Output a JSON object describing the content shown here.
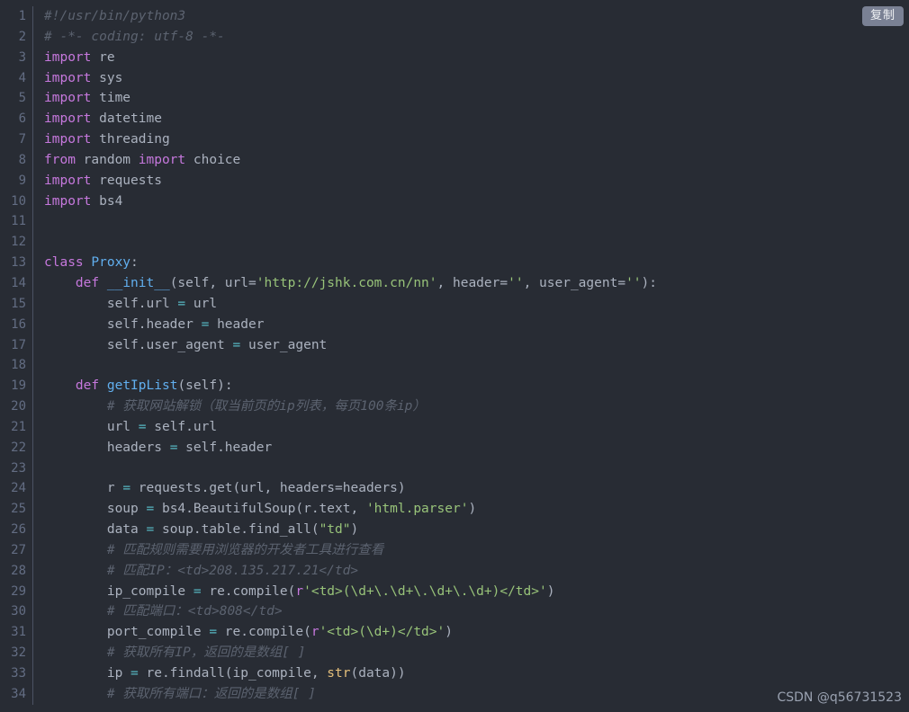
{
  "editor": {
    "language": "python",
    "theme_background": "#282c34",
    "gutter_divider_color": "#4b5263",
    "copy_button_label": "复制",
    "copy_button_color": "#7a8194",
    "watermark": "CSDN @q56731523",
    "first_line_number": 1,
    "last_line_number": 34,
    "line_numbers": [
      "1",
      "2",
      "3",
      "4",
      "5",
      "6",
      "7",
      "8",
      "9",
      "10",
      "11",
      "12",
      "13",
      "14",
      "15",
      "16",
      "17",
      "18",
      "19",
      "20",
      "21",
      "22",
      "23",
      "24",
      "25",
      "26",
      "27",
      "28",
      "29",
      "30",
      "31",
      "32",
      "33",
      "34"
    ],
    "colors": {
      "keyword": "#c678dd",
      "function": "#61afef",
      "string": "#98c379",
      "comment": "#5c6370",
      "operator": "#56b6c2",
      "builtin": "#e5c07b",
      "plain": "#abb2bf",
      "line_number": "#636d83"
    },
    "lines": [
      {
        "n": 1,
        "tokens": [
          {
            "t": "#!/usr/bin/python3",
            "c": "com"
          }
        ]
      },
      {
        "n": 2,
        "tokens": [
          {
            "t": "# -*- coding: utf-8 -*-",
            "c": "com"
          }
        ]
      },
      {
        "n": 3,
        "tokens": [
          {
            "t": "import",
            "c": "kw"
          },
          {
            "t": " re",
            "c": "pl"
          }
        ]
      },
      {
        "n": 4,
        "tokens": [
          {
            "t": "import",
            "c": "kw"
          },
          {
            "t": " sys",
            "c": "pl"
          }
        ]
      },
      {
        "n": 5,
        "tokens": [
          {
            "t": "import",
            "c": "kw"
          },
          {
            "t": " time",
            "c": "pl"
          }
        ]
      },
      {
        "n": 6,
        "tokens": [
          {
            "t": "import",
            "c": "kw"
          },
          {
            "t": " datetime",
            "c": "pl"
          }
        ]
      },
      {
        "n": 7,
        "tokens": [
          {
            "t": "import",
            "c": "kw"
          },
          {
            "t": " threading",
            "c": "pl"
          }
        ]
      },
      {
        "n": 8,
        "tokens": [
          {
            "t": "from",
            "c": "kw"
          },
          {
            "t": " random ",
            "c": "pl"
          },
          {
            "t": "import",
            "c": "kw"
          },
          {
            "t": " choice",
            "c": "pl"
          }
        ]
      },
      {
        "n": 9,
        "tokens": [
          {
            "t": "import",
            "c": "kw"
          },
          {
            "t": " requests",
            "c": "pl"
          }
        ]
      },
      {
        "n": 10,
        "tokens": [
          {
            "t": "import",
            "c": "kw"
          },
          {
            "t": " bs4",
            "c": "pl"
          }
        ]
      },
      {
        "n": 11,
        "tokens": []
      },
      {
        "n": 12,
        "tokens": []
      },
      {
        "n": 13,
        "tokens": [
          {
            "t": "class",
            "c": "kw"
          },
          {
            "t": " ",
            "c": "pl"
          },
          {
            "t": "Proxy",
            "c": "fn"
          },
          {
            "t": ":",
            "c": "pn"
          }
        ]
      },
      {
        "n": 14,
        "tokens": [
          {
            "t": "    ",
            "c": "pl"
          },
          {
            "t": "def",
            "c": "kw"
          },
          {
            "t": " ",
            "c": "pl"
          },
          {
            "t": "__init__",
            "c": "fn"
          },
          {
            "t": "(self, url=",
            "c": "pl"
          },
          {
            "t": "'http://jshk.com.cn/nn'",
            "c": "str"
          },
          {
            "t": ", header=",
            "c": "pl"
          },
          {
            "t": "''",
            "c": "str"
          },
          {
            "t": ", user_agent=",
            "c": "pl"
          },
          {
            "t": "''",
            "c": "str"
          },
          {
            "t": "):",
            "c": "pl"
          }
        ]
      },
      {
        "n": 15,
        "tokens": [
          {
            "t": "        self.url ",
            "c": "pl"
          },
          {
            "t": "=",
            "c": "op"
          },
          {
            "t": " url",
            "c": "pl"
          }
        ]
      },
      {
        "n": 16,
        "tokens": [
          {
            "t": "        self.header ",
            "c": "pl"
          },
          {
            "t": "=",
            "c": "op"
          },
          {
            "t": " header",
            "c": "pl"
          }
        ]
      },
      {
        "n": 17,
        "tokens": [
          {
            "t": "        self.user_agent ",
            "c": "pl"
          },
          {
            "t": "=",
            "c": "op"
          },
          {
            "t": " user_agent",
            "c": "pl"
          }
        ]
      },
      {
        "n": 18,
        "tokens": []
      },
      {
        "n": 19,
        "tokens": [
          {
            "t": "    ",
            "c": "pl"
          },
          {
            "t": "def",
            "c": "kw"
          },
          {
            "t": " ",
            "c": "pl"
          },
          {
            "t": "getIpList",
            "c": "fn"
          },
          {
            "t": "(self):",
            "c": "pl"
          }
        ]
      },
      {
        "n": 20,
        "tokens": [
          {
            "t": "        # 获取网站解锁（取当前页的ip列表，每页100条ip）",
            "c": "com"
          }
        ]
      },
      {
        "n": 21,
        "tokens": [
          {
            "t": "        url ",
            "c": "pl"
          },
          {
            "t": "=",
            "c": "op"
          },
          {
            "t": " self.url",
            "c": "pl"
          }
        ]
      },
      {
        "n": 22,
        "tokens": [
          {
            "t": "        headers ",
            "c": "pl"
          },
          {
            "t": "=",
            "c": "op"
          },
          {
            "t": " self.header",
            "c": "pl"
          }
        ]
      },
      {
        "n": 23,
        "tokens": []
      },
      {
        "n": 24,
        "tokens": [
          {
            "t": "        r ",
            "c": "pl"
          },
          {
            "t": "=",
            "c": "op"
          },
          {
            "t": " requests.get(url, headers=headers)",
            "c": "pl"
          }
        ]
      },
      {
        "n": 25,
        "tokens": [
          {
            "t": "        soup ",
            "c": "pl"
          },
          {
            "t": "=",
            "c": "op"
          },
          {
            "t": " bs4.BeautifulSoup(r.text, ",
            "c": "pl"
          },
          {
            "t": "'html.parser'",
            "c": "str"
          },
          {
            "t": ")",
            "c": "pl"
          }
        ]
      },
      {
        "n": 26,
        "tokens": [
          {
            "t": "        data ",
            "c": "pl"
          },
          {
            "t": "=",
            "c": "op"
          },
          {
            "t": " soup.table.find_all(",
            "c": "pl"
          },
          {
            "t": "\"td\"",
            "c": "str"
          },
          {
            "t": ")",
            "c": "pl"
          }
        ]
      },
      {
        "n": 27,
        "tokens": [
          {
            "t": "        # 匹配规则需要用浏览器的开发者工具进行查看",
            "c": "com"
          }
        ]
      },
      {
        "n": 28,
        "tokens": [
          {
            "t": "        # 匹配IP：<td>208.135.217.21</td>",
            "c": "com"
          }
        ]
      },
      {
        "n": 29,
        "tokens": [
          {
            "t": "        ip_compile ",
            "c": "pl"
          },
          {
            "t": "=",
            "c": "op"
          },
          {
            "t": " re.compile(",
            "c": "pl"
          },
          {
            "t": "r",
            "c": "kw"
          },
          {
            "t": "'<td>(\\d+\\.\\d+\\.\\d+\\.\\d+)</td>'",
            "c": "str"
          },
          {
            "t": ")",
            "c": "pl"
          }
        ]
      },
      {
        "n": 30,
        "tokens": [
          {
            "t": "        # 匹配端口：<td>808</td>",
            "c": "com"
          }
        ]
      },
      {
        "n": 31,
        "tokens": [
          {
            "t": "        port_compile ",
            "c": "pl"
          },
          {
            "t": "=",
            "c": "op"
          },
          {
            "t": " re.compile(",
            "c": "pl"
          },
          {
            "t": "r",
            "c": "kw"
          },
          {
            "t": "'<td>(\\d+)</td>'",
            "c": "str"
          },
          {
            "t": ")",
            "c": "pl"
          }
        ]
      },
      {
        "n": 32,
        "tokens": [
          {
            "t": "        # 获取所有IP，返回的是数组[ ]",
            "c": "com"
          }
        ]
      },
      {
        "n": 33,
        "tokens": [
          {
            "t": "        ip ",
            "c": "pl"
          },
          {
            "t": "=",
            "c": "op"
          },
          {
            "t": " re.findall(ip_compile, ",
            "c": "pl"
          },
          {
            "t": "str",
            "c": "bi"
          },
          {
            "t": "(data))",
            "c": "pl"
          }
        ]
      },
      {
        "n": 34,
        "tokens": [
          {
            "t": "        # 获取所有端口：返回的是数组[ ]",
            "c": "com"
          }
        ]
      }
    ]
  }
}
